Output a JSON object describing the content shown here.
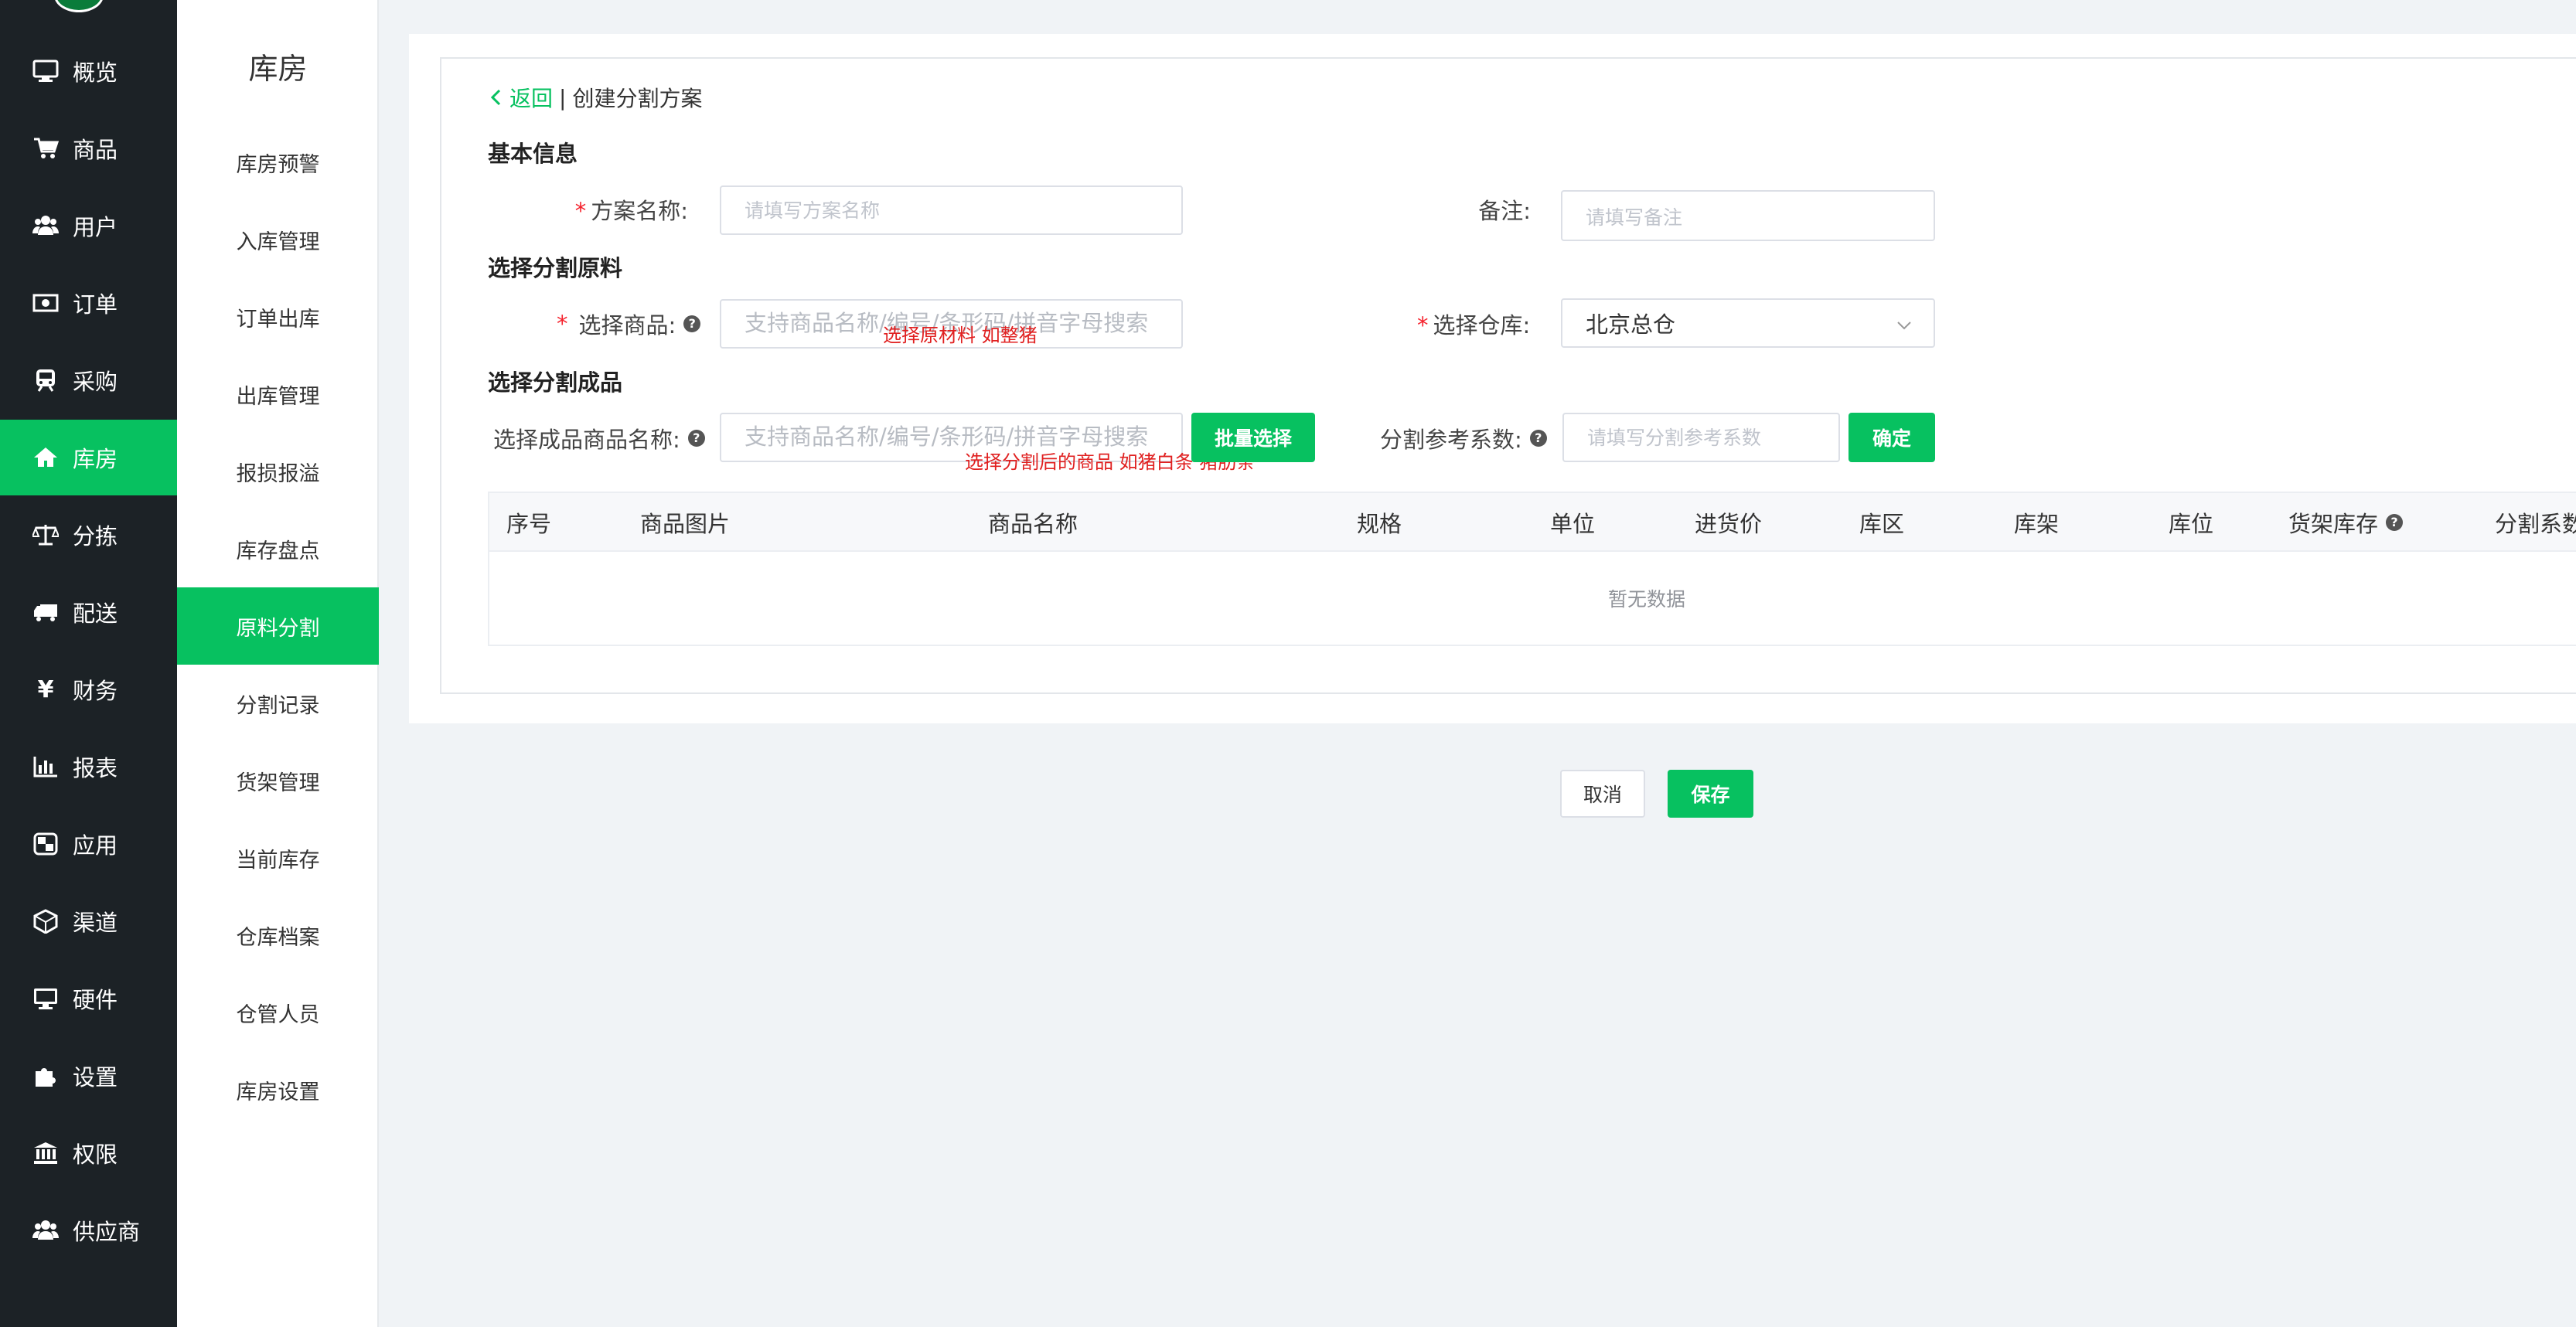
{
  "sidebar": {
    "items": [
      {
        "label": "概览",
        "icon": "monitor-icon"
      },
      {
        "label": "商品",
        "icon": "cart-icon"
      },
      {
        "label": "用户",
        "icon": "users-icon"
      },
      {
        "label": "订单",
        "icon": "money-icon"
      },
      {
        "label": "采购",
        "icon": "train-icon"
      },
      {
        "label": "库房",
        "icon": "home-icon"
      },
      {
        "label": "分拣",
        "icon": "scale-icon"
      },
      {
        "label": "配送",
        "icon": "truck-icon"
      },
      {
        "label": "财务",
        "icon": "yen-icon"
      },
      {
        "label": "报表",
        "icon": "bar-chart-icon"
      },
      {
        "label": "应用",
        "icon": "apps-icon"
      },
      {
        "label": "渠道",
        "icon": "cube-icon"
      },
      {
        "label": "硬件",
        "icon": "desktop-icon"
      },
      {
        "label": "设置",
        "icon": "puzzle-icon"
      },
      {
        "label": "权限",
        "icon": "bank-icon"
      },
      {
        "label": "供应商",
        "icon": "users-icon"
      }
    ],
    "active_index": 5,
    "accent": "#07c160"
  },
  "subnav": {
    "title": "库房",
    "items": [
      "库房预警",
      "入库管理",
      "订单出库",
      "出库管理",
      "报损报溢",
      "库存盘点",
      "原料分割",
      "分割记录",
      "货架管理",
      "当前库存",
      "仓库档案",
      "仓管人员",
      "库房设置"
    ],
    "active_index": 6
  },
  "header": {
    "back_label": "返回",
    "separator": "|",
    "page_title": "创建分割方案"
  },
  "basic_info": {
    "section_title": "基本信息",
    "plan_name_label": "方案名称:",
    "plan_name_placeholder": "请填写方案名称",
    "remark_label": "备注:",
    "remark_placeholder": "请填写备注"
  },
  "raw_material": {
    "section_title": "选择分割原料",
    "product_label": "选择商品:",
    "product_placeholder": "支持商品名称/编号/条形码/拼音字母搜索",
    "product_annotation": "选择原材料   如整猪",
    "warehouse_label": "选择仓库:",
    "warehouse_value": "北京总仓"
  },
  "finished_product": {
    "section_title": "选择分割成品",
    "product_label": "选择成品商品名称:",
    "product_placeholder": "支持商品名称/编号/条形码/拼音字母搜索",
    "product_annotation": "选择分割后的商品    如猪白条  猪肋条",
    "batch_button": "批量选择",
    "coef_label": "分割参考系数:",
    "coef_placeholder": "请填写分割参考系数",
    "confirm_button": "确定"
  },
  "table": {
    "columns": [
      "序号",
      "商品图片",
      "商品名称",
      "规格",
      "单位",
      "进货价",
      "库区",
      "库架",
      "库位",
      "货架库存",
      "分割系数"
    ],
    "empty_text": "暂无数据"
  },
  "footer": {
    "cancel_button": "取消",
    "save_button": "保存"
  }
}
